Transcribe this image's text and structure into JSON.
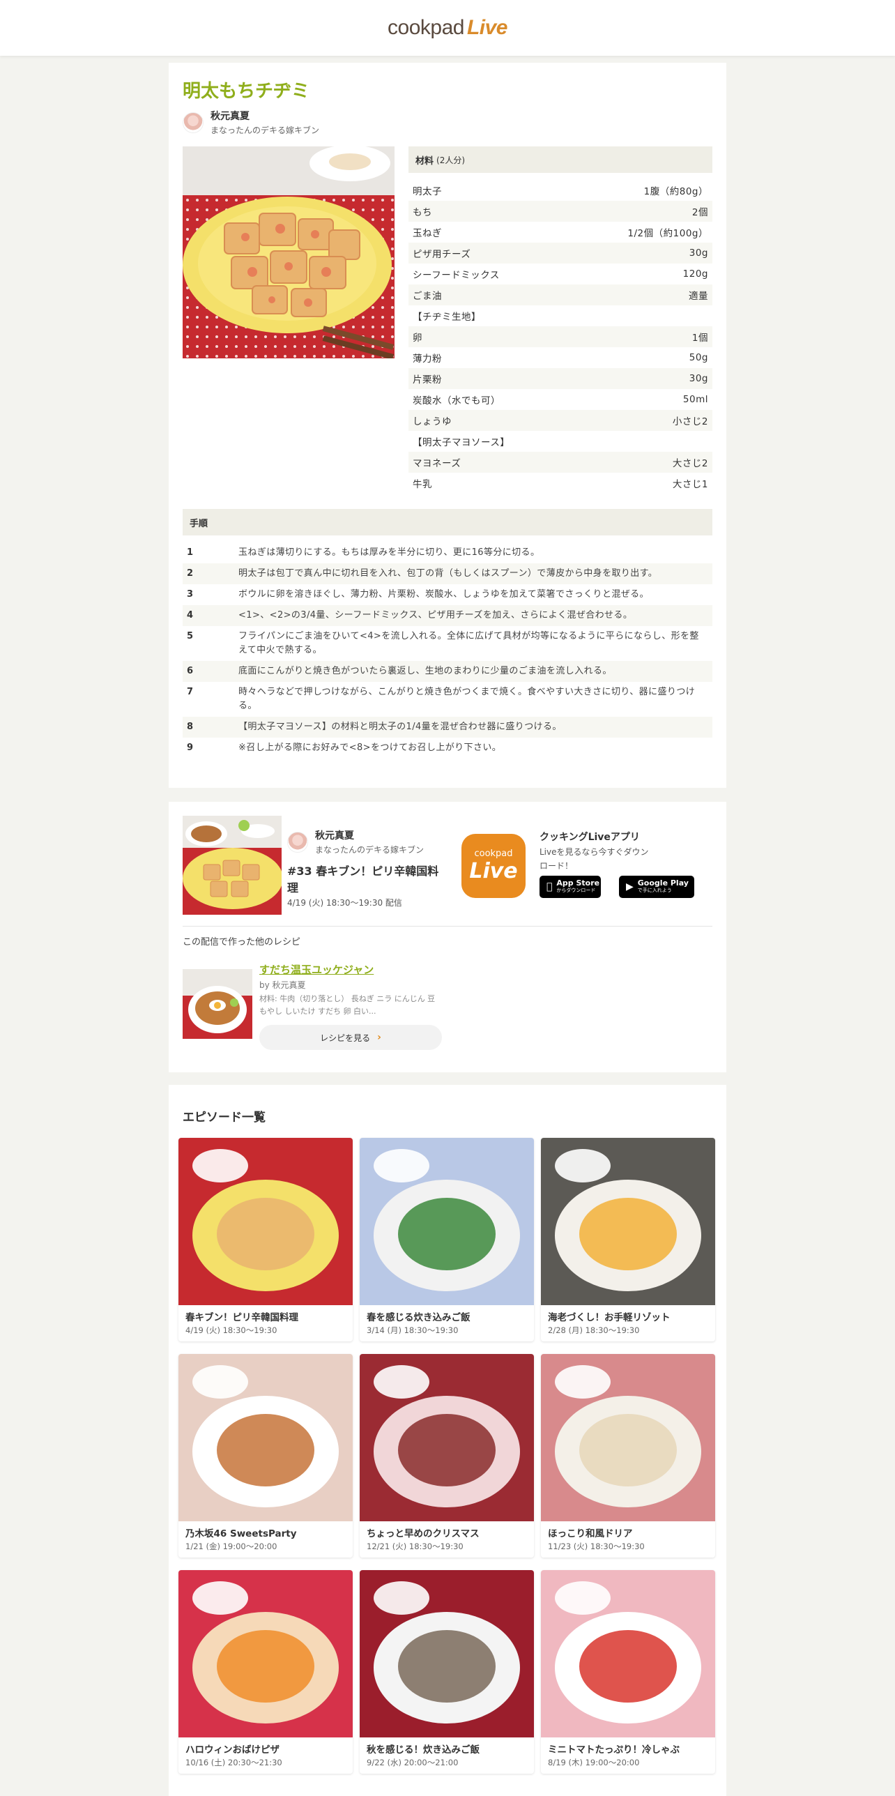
{
  "header": {
    "logo_main": "cookpad",
    "logo_live": "Live"
  },
  "recipe": {
    "title": "明太もちチヂミ",
    "author": {
      "name": "秋元真夏",
      "subtitle": "まなったんのデキる嫁キブン"
    },
    "ingredients_label": "材料",
    "servings": "(2人分)",
    "ingredients": [
      {
        "name": "明太子",
        "amount": "1腹（約80g）"
      },
      {
        "name": "もち",
        "amount": "2個"
      },
      {
        "name": "玉ねぎ",
        "amount": "1/2個（約100g）"
      },
      {
        "name": "ピザ用チーズ",
        "amount": "30g"
      },
      {
        "name": "シーフードミックス",
        "amount": "120g"
      },
      {
        "name": "ごま油",
        "amount": "適量"
      },
      {
        "name": "【チヂミ生地】",
        "amount": ""
      },
      {
        "name": "卵",
        "amount": "1個"
      },
      {
        "name": "薄力粉",
        "amount": "50g"
      },
      {
        "name": "片栗粉",
        "amount": "30g"
      },
      {
        "name": "炭酸水（水でも可）",
        "amount": "50ml"
      },
      {
        "name": "しょうゆ",
        "amount": "小さじ2"
      },
      {
        "name": "【明太子マヨソース】",
        "amount": ""
      },
      {
        "name": "マヨネーズ",
        "amount": "大さじ2"
      },
      {
        "name": "牛乳",
        "amount": "大さじ1"
      }
    ],
    "steps_label": "手順",
    "steps": [
      {
        "num": "1",
        "text": "玉ねぎは薄切りにする。もちは厚みを半分に切り、更に16等分に切る。"
      },
      {
        "num": "2",
        "text": "明太子は包丁で真ん中に切れ目を入れ、包丁の背（もしくはスプーン）で薄皮から中身を取り出す。"
      },
      {
        "num": "3",
        "text": "ボウルに卵を溶きほぐし、薄力粉、片栗粉、炭酸水、しょうゆを加えて菜箸でさっくりと混ぜる。"
      },
      {
        "num": "4",
        "text": "<1>、<2>の3/4量、シーフードミックス、ピザ用チーズを加え、さらによく混ぜ合わせる。"
      },
      {
        "num": "5",
        "text": "フライパンにごま油をひいて<4>を流し入れる。全体に広げて具材が均等になるように平らにならし、形を整えて中火で熱する。"
      },
      {
        "num": "6",
        "text": "底面にこんがりと焼き色がついたら裏返し、生地のまわりに少量のごま油を流し入れる。"
      },
      {
        "num": "7",
        "text": "時々ヘラなどで押しつけながら、こんがりと焼き色がつくまで焼く。食べやすい大きさに切り、器に盛りつける。"
      },
      {
        "num": "8",
        "text": "【明太子マヨソース】の材料と明太子の1/4量を混ぜ合わせ器に盛りつける。"
      },
      {
        "num": "9",
        "text": "※召し上がる際にお好みで<8>をつけてお召し上がり下さい。"
      }
    ]
  },
  "stream": {
    "author_name": "秋元真夏",
    "author_sub": "まなったんのデキる嫁キブン",
    "title": "#33 春キブン！ピリ辛韓国料理",
    "date": "4/19 (火) 18:30〜19:30 配信",
    "app_icon_small": "cookpad",
    "app_icon_big": "Live",
    "app_title": "クッキングLiveアプリ",
    "app_desc": "Liveを見るなら今すぐダウンロード！",
    "appstore_top": "App Store",
    "appstore_bot": "からダウンロード",
    "gplay_top": "Google Play",
    "gplay_bot": "で手に入れよう",
    "other_label": "この配信で作った他のレシピ",
    "other": {
      "title": "すだち温玉ユッケジャン",
      "by": "by 秋元真夏",
      "materials": "材料: 牛肉（切り落とし） 長ねぎ ニラ にんじん 豆もやし しいたけ すだち 卵 白い...",
      "button": "レシピを見る"
    }
  },
  "episodes": {
    "heading": "エピソード一覧",
    "items": [
      {
        "title": "春キブン！ピリ辛韓国料理",
        "date": "4/19 (火) 18:30〜19:30"
      },
      {
        "title": "春を感じる炊き込みご飯",
        "date": "3/14 (月) 18:30〜19:30"
      },
      {
        "title": "海老づくし！お手軽リゾット",
        "date": "2/28 (月) 18:30〜19:30"
      },
      {
        "title": "乃木坂46 SweetsParty",
        "date": "1/21 (金) 19:00〜20:00"
      },
      {
        "title": "ちょっと早めのクリスマス",
        "date": "12/21 (火) 18:30〜19:30"
      },
      {
        "title": "ほっこり和風ドリア",
        "date": "11/23 (火) 18:30〜19:30"
      },
      {
        "title": "ハロウィンおばけピザ",
        "date": "10/16 (土) 20:30〜21:30"
      },
      {
        "title": "秋を感じる！炊き込みご飯",
        "date": "9/22 (水) 20:00〜21:00"
      },
      {
        "title": "ミニトマトたっぷり！冷しゃぶ",
        "date": "8/19 (木) 19:00〜20:00"
      }
    ]
  }
}
